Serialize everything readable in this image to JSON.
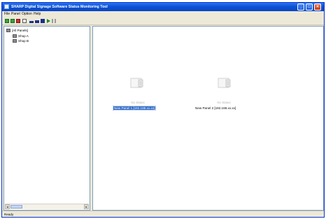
{
  "window": {
    "title": "SHARP Digital Signage Software Status Monitoring Tool",
    "min_symbol": "_",
    "max_symbol": "□",
    "close_symbol": "×"
  },
  "menu": [
    "File",
    "Panel",
    "Option",
    "Help"
  ],
  "toolbar": {
    "icons": [
      "green-square-icon",
      "green-square-icon",
      "red-square-icon",
      "properties-icon",
      "panel-small-icon",
      "panel-medium-icon",
      "panel-large-icon",
      "play-icon",
      "pause-icon"
    ]
  },
  "tree": {
    "root": "[All Panels]",
    "children": [
      "Shop A",
      "Shop B"
    ]
  },
  "panels": [
    {
      "status": "No Status",
      "name": "New Panel 1 [192.168.xx.xx]",
      "selected": true
    },
    {
      "status": "No Status",
      "name": "New Panel 2 [192.168.xx.xx]",
      "selected": false
    }
  ],
  "statusbar": {
    "text": "Ready"
  },
  "colors": {
    "titlebar": "#0b53d6",
    "selection": "#316ac5",
    "chrome": "#ece9d8"
  }
}
